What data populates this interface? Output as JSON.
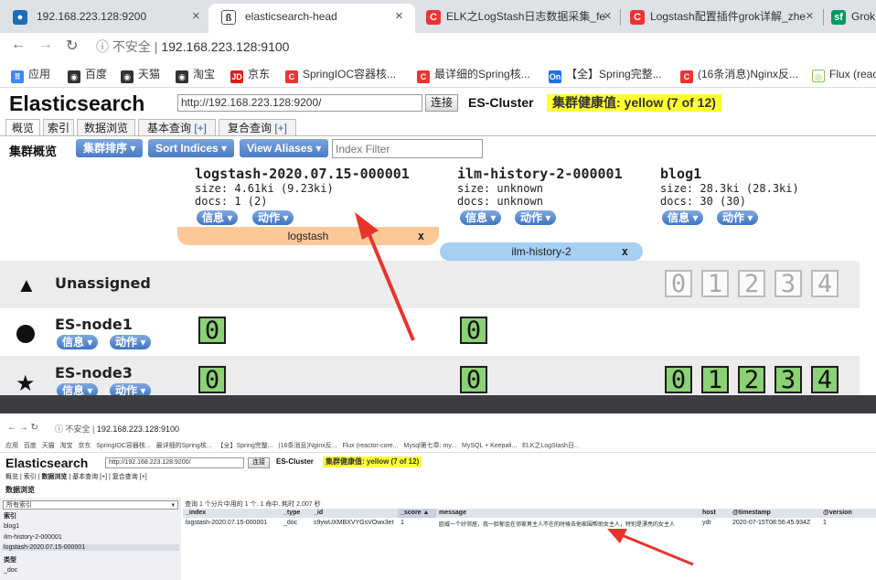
{
  "browser": {
    "tabs": [
      {
        "title": "192.168.223.128:9200",
        "icon": "server-icon"
      },
      {
        "title": "elasticsearch-head",
        "icon": "es-head-icon"
      },
      {
        "title": "ELK之LogStash日志数据采集_fe",
        "icon": "csdn-icon"
      },
      {
        "title": "Logstash配置插件grok详解_zhe",
        "icon": "csdn-icon"
      },
      {
        "title": "Grok",
        "icon": "sf-icon"
      }
    ],
    "close_glyph": "×",
    "insecure_label": "不安全",
    "url": "192.168.223.128:9100",
    "bookmarks": [
      "应用",
      "百度",
      "天猫",
      "淘宝",
      "京东",
      "SpringIOC容器核...",
      "最详细的Spring核...",
      "【全】Spring完整...",
      "(16条消息)Nginx反...",
      "Flux (reac"
    ]
  },
  "es": {
    "title": "Elasticsearch",
    "connect_url": "http://192.168.223.128:9200/",
    "connect_label": "连接",
    "cluster_name": "ES-Cluster",
    "health": "集群健康值: yellow (7 of 12)",
    "nav_tabs": [
      {
        "label": "概览",
        "plus": ""
      },
      {
        "label": "索引",
        "plus": ""
      },
      {
        "label": "数据浏览",
        "plus": ""
      },
      {
        "label": "基本查询",
        "plus": "[+]"
      },
      {
        "label": "复合查询",
        "plus": "[+]"
      }
    ],
    "overview_label": "集群概览",
    "sort_cluster": "集群排序 ▾",
    "sort_indices": "Sort Indices ▾",
    "view_aliases": "View Aliases ▾",
    "index_filter_placeholder": "Index Filter",
    "info_label": "信息 ▾",
    "action_label": "动作 ▾",
    "indices": [
      {
        "name": "logstash-2020.07.15-000001",
        "size": "size: 4.61ki (9.23ki)",
        "docs": "docs: 1 (2)"
      },
      {
        "name": "ilm-history-2-000001",
        "size": "size: unknown",
        "docs": "docs: unknown"
      },
      {
        "name": "blog1",
        "size": "size: 28.3ki (28.3ki)",
        "docs": "docs: 30 (30)"
      }
    ],
    "aliases": [
      {
        "name": "logstash",
        "close": "x",
        "color": "#fbc998"
      },
      {
        "name": "ilm-history-2",
        "close": "x",
        "color": "#a6cff2"
      }
    ],
    "rows": [
      {
        "name": "Unassigned",
        "icon": "warning-icon",
        "shards": [
          "0",
          "1",
          "2",
          "3",
          "4"
        ]
      },
      {
        "name": "ES-node1",
        "icon": "circle-icon",
        "shards": [
          "0",
          "0"
        ]
      },
      {
        "name": "ES-node3",
        "icon": "star-icon",
        "shards": [
          "0",
          "0",
          "0",
          "1",
          "2",
          "3",
          "4"
        ]
      }
    ]
  },
  "bottom": {
    "url": "192.168.223.128:9100",
    "insecure_label": "不安全",
    "bookmarks": [
      "应用",
      "百度",
      "天猫",
      "淘宝",
      "京东",
      "SpringIOC容器核...",
      "最详细的Spring核...",
      "【全】Spring完整...",
      "(16条消息)Nginx反...",
      "Flux (reactor-core...",
      "Mysql第七章: my...",
      "MySQL + Keepali...",
      "ELK之LogStash日..."
    ],
    "title": "Elasticsearch",
    "connect_url": "http://192.168.223.128:9200/",
    "connect_label": "连接",
    "cluster_name": "ES-Cluster",
    "health": "集群健康值: yellow (7 of 12)",
    "nav_tabs": [
      "概览",
      "索引",
      "数据浏览",
      "基本查询 [+]",
      "复合查询 [+]"
    ],
    "browser_label": "数据浏览",
    "all_indices": "所有索引",
    "sidebar_index_heading": "索引",
    "sidebar_indices": [
      "blog1",
      "ilm-history-2-000001",
      "logstash-2020.07.15-000001"
    ],
    "sidebar_type_heading": "类型",
    "sidebar_types": [
      "_doc"
    ],
    "query_info": "查询 1 个分片中用的 1 个. 1 命中. 耗时 2.007 秒",
    "columns": [
      "_index",
      "_type",
      "_id",
      "_score ▲",
      "message",
      "host",
      "@timestamp",
      "@version"
    ],
    "rows": [
      [
        "logstash-2020.07.15-000001",
        "_doc",
        "s9ywUXMBXVYGsVOwx3et",
        "1",
        "欧威一个好邻居，我一脸郁金在邻家男主人不在的时候去他家围帮助女主人，特别是漂亮的女主人",
        "ydt",
        "2020-07-15T08:56:45.934Z",
        "1"
      ]
    ]
  }
}
